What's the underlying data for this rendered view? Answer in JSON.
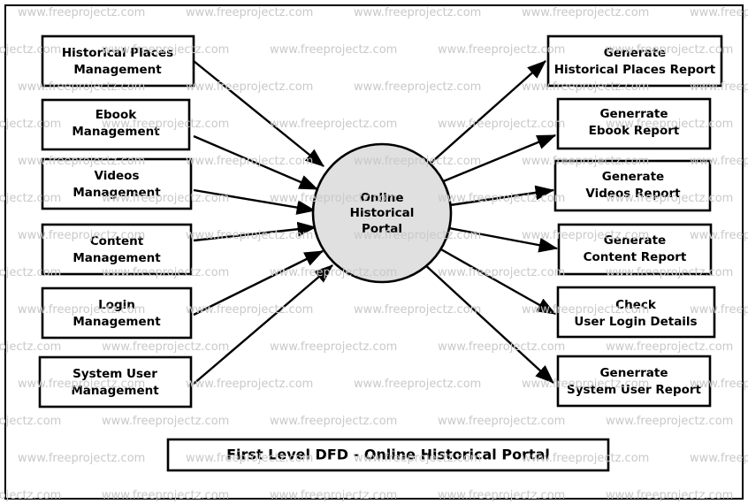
{
  "diagram": {
    "title": "First Level DFD - Online Historical Portal",
    "watermark_text": "www.freeprojectz.com",
    "process": {
      "name": "Online Historical Portal",
      "lines": [
        "Online",
        "Historical",
        "Portal"
      ],
      "fill_color": "#e0e0e0",
      "stroke_color": "#000000"
    },
    "inputs": [
      {
        "id": "historical-places-management",
        "lines": [
          "Historical Places",
          "Management"
        ]
      },
      {
        "id": "ebook-management",
        "lines": [
          "Ebook",
          "Management"
        ]
      },
      {
        "id": "videos-management",
        "lines": [
          "Videos",
          "Management"
        ]
      },
      {
        "id": "content-management",
        "lines": [
          "Content",
          "Management"
        ]
      },
      {
        "id": "login-management",
        "lines": [
          "Login",
          "Management"
        ]
      },
      {
        "id": "system-user-management",
        "lines": [
          "System User",
          "Management"
        ]
      }
    ],
    "outputs": [
      {
        "id": "generate-historical-places-report",
        "lines": [
          "Generate",
          "Historical Places Report"
        ]
      },
      {
        "id": "generrate-ebook-report",
        "lines": [
          "Generrate",
          "Ebook Report"
        ]
      },
      {
        "id": "generate-videos-report",
        "lines": [
          "Generate",
          "Videos Report"
        ]
      },
      {
        "id": "generate-content-report",
        "lines": [
          "Generate",
          "Content Report"
        ]
      },
      {
        "id": "check-user-login-details",
        "lines": [
          "Check",
          "User Login Details"
        ]
      },
      {
        "id": "generrate-system-user-report",
        "lines": [
          "Generrate",
          "System User Report"
        ]
      }
    ]
  }
}
